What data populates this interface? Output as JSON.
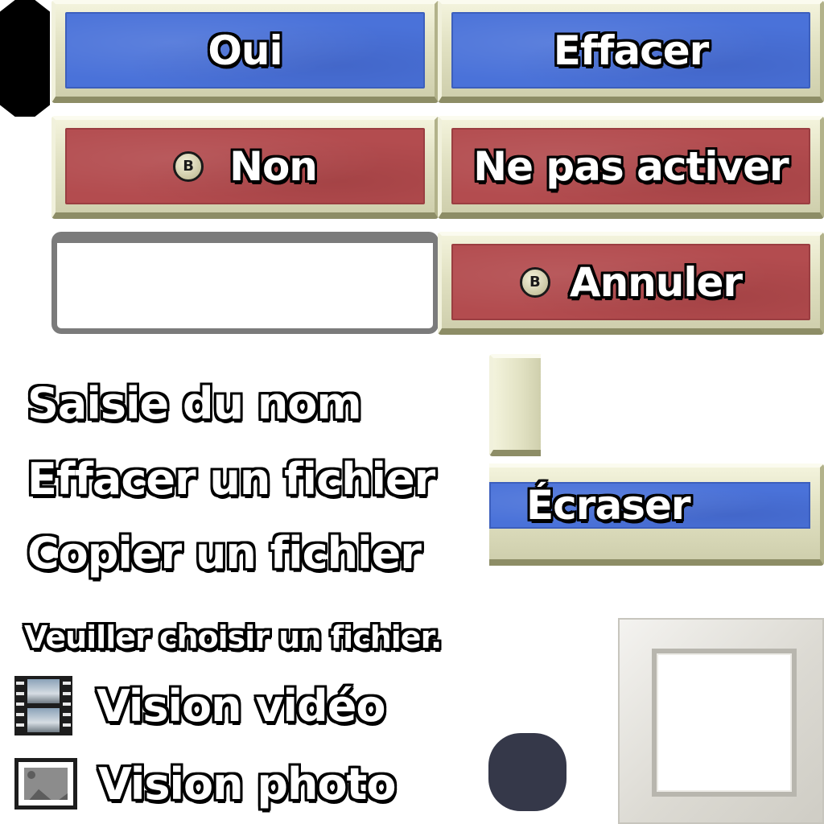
{
  "buttons": {
    "oui": "Oui",
    "effacer": "Effacer",
    "non": "Non",
    "ne_pas_activer": "Ne pas activer",
    "annuler": "Annuler",
    "ecraser": "Écraser"
  },
  "b_icon_letter": "B",
  "menu": {
    "saisie_du_nom": "Saisie du nom",
    "effacer_un_fichier": "Effacer un fichier",
    "copier_un_fichier": "Copier un fichier"
  },
  "prompt": "Veuiller choisir un fichier.",
  "modes": {
    "video": {
      "label": "Vision vidéo",
      "icon": "film-icon"
    },
    "photo": {
      "label": "Vision photo",
      "icon": "photo-icon"
    }
  },
  "colors": {
    "confirm_blue": "#4a72d9",
    "cancel_red": "#b34c4f",
    "frame_cream": "#e1e1c2",
    "badge_dark": "#353849",
    "panel_gray": "#7b7b7b"
  }
}
